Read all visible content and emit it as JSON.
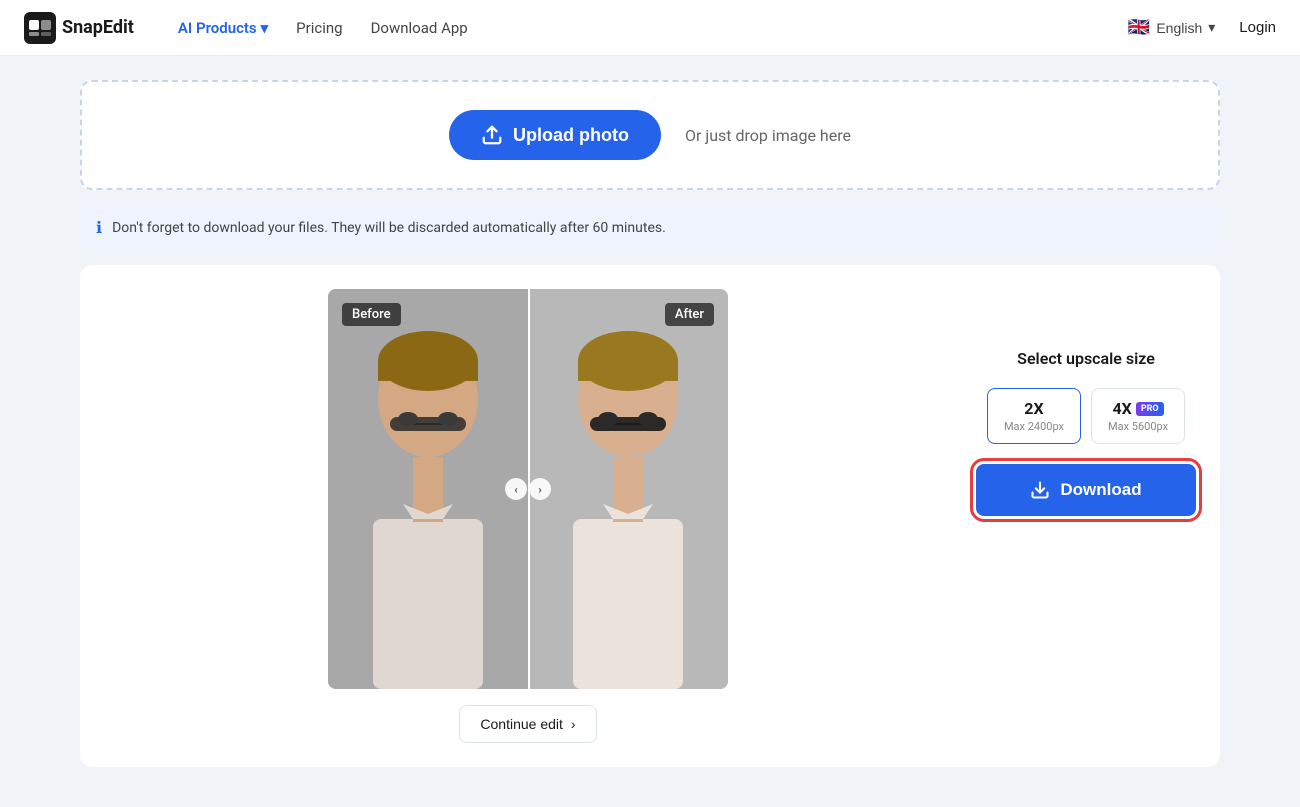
{
  "brand": {
    "name": "SnapEdit",
    "logo_alt": "SnapEdit logo"
  },
  "nav": {
    "links": [
      {
        "id": "ai-products",
        "label": "AI Products",
        "active": true,
        "has_dropdown": true
      },
      {
        "id": "pricing",
        "label": "Pricing",
        "active": false,
        "has_dropdown": false
      },
      {
        "id": "download-app",
        "label": "Download App",
        "active": false,
        "has_dropdown": false
      }
    ],
    "language": "English",
    "flag": "🇬🇧",
    "login_label": "Login"
  },
  "upload": {
    "button_label": "Upload photo",
    "drop_text": "Or just drop image here"
  },
  "info_bar": {
    "message": "Don't forget to download your files. They will be discarded automatically after 60 minutes."
  },
  "compare": {
    "before_label": "Before",
    "after_label": "After",
    "continue_edit_label": "Continue edit"
  },
  "sidebar": {
    "select_size_label": "Select upscale size",
    "options": [
      {
        "id": "2x",
        "multiplier": "2X",
        "max_px": "Max 2400px",
        "selected": true,
        "pro": false
      },
      {
        "id": "4x",
        "multiplier": "4X",
        "max_px": "Max 5600px",
        "selected": false,
        "pro": true
      }
    ],
    "download_label": "Download"
  }
}
